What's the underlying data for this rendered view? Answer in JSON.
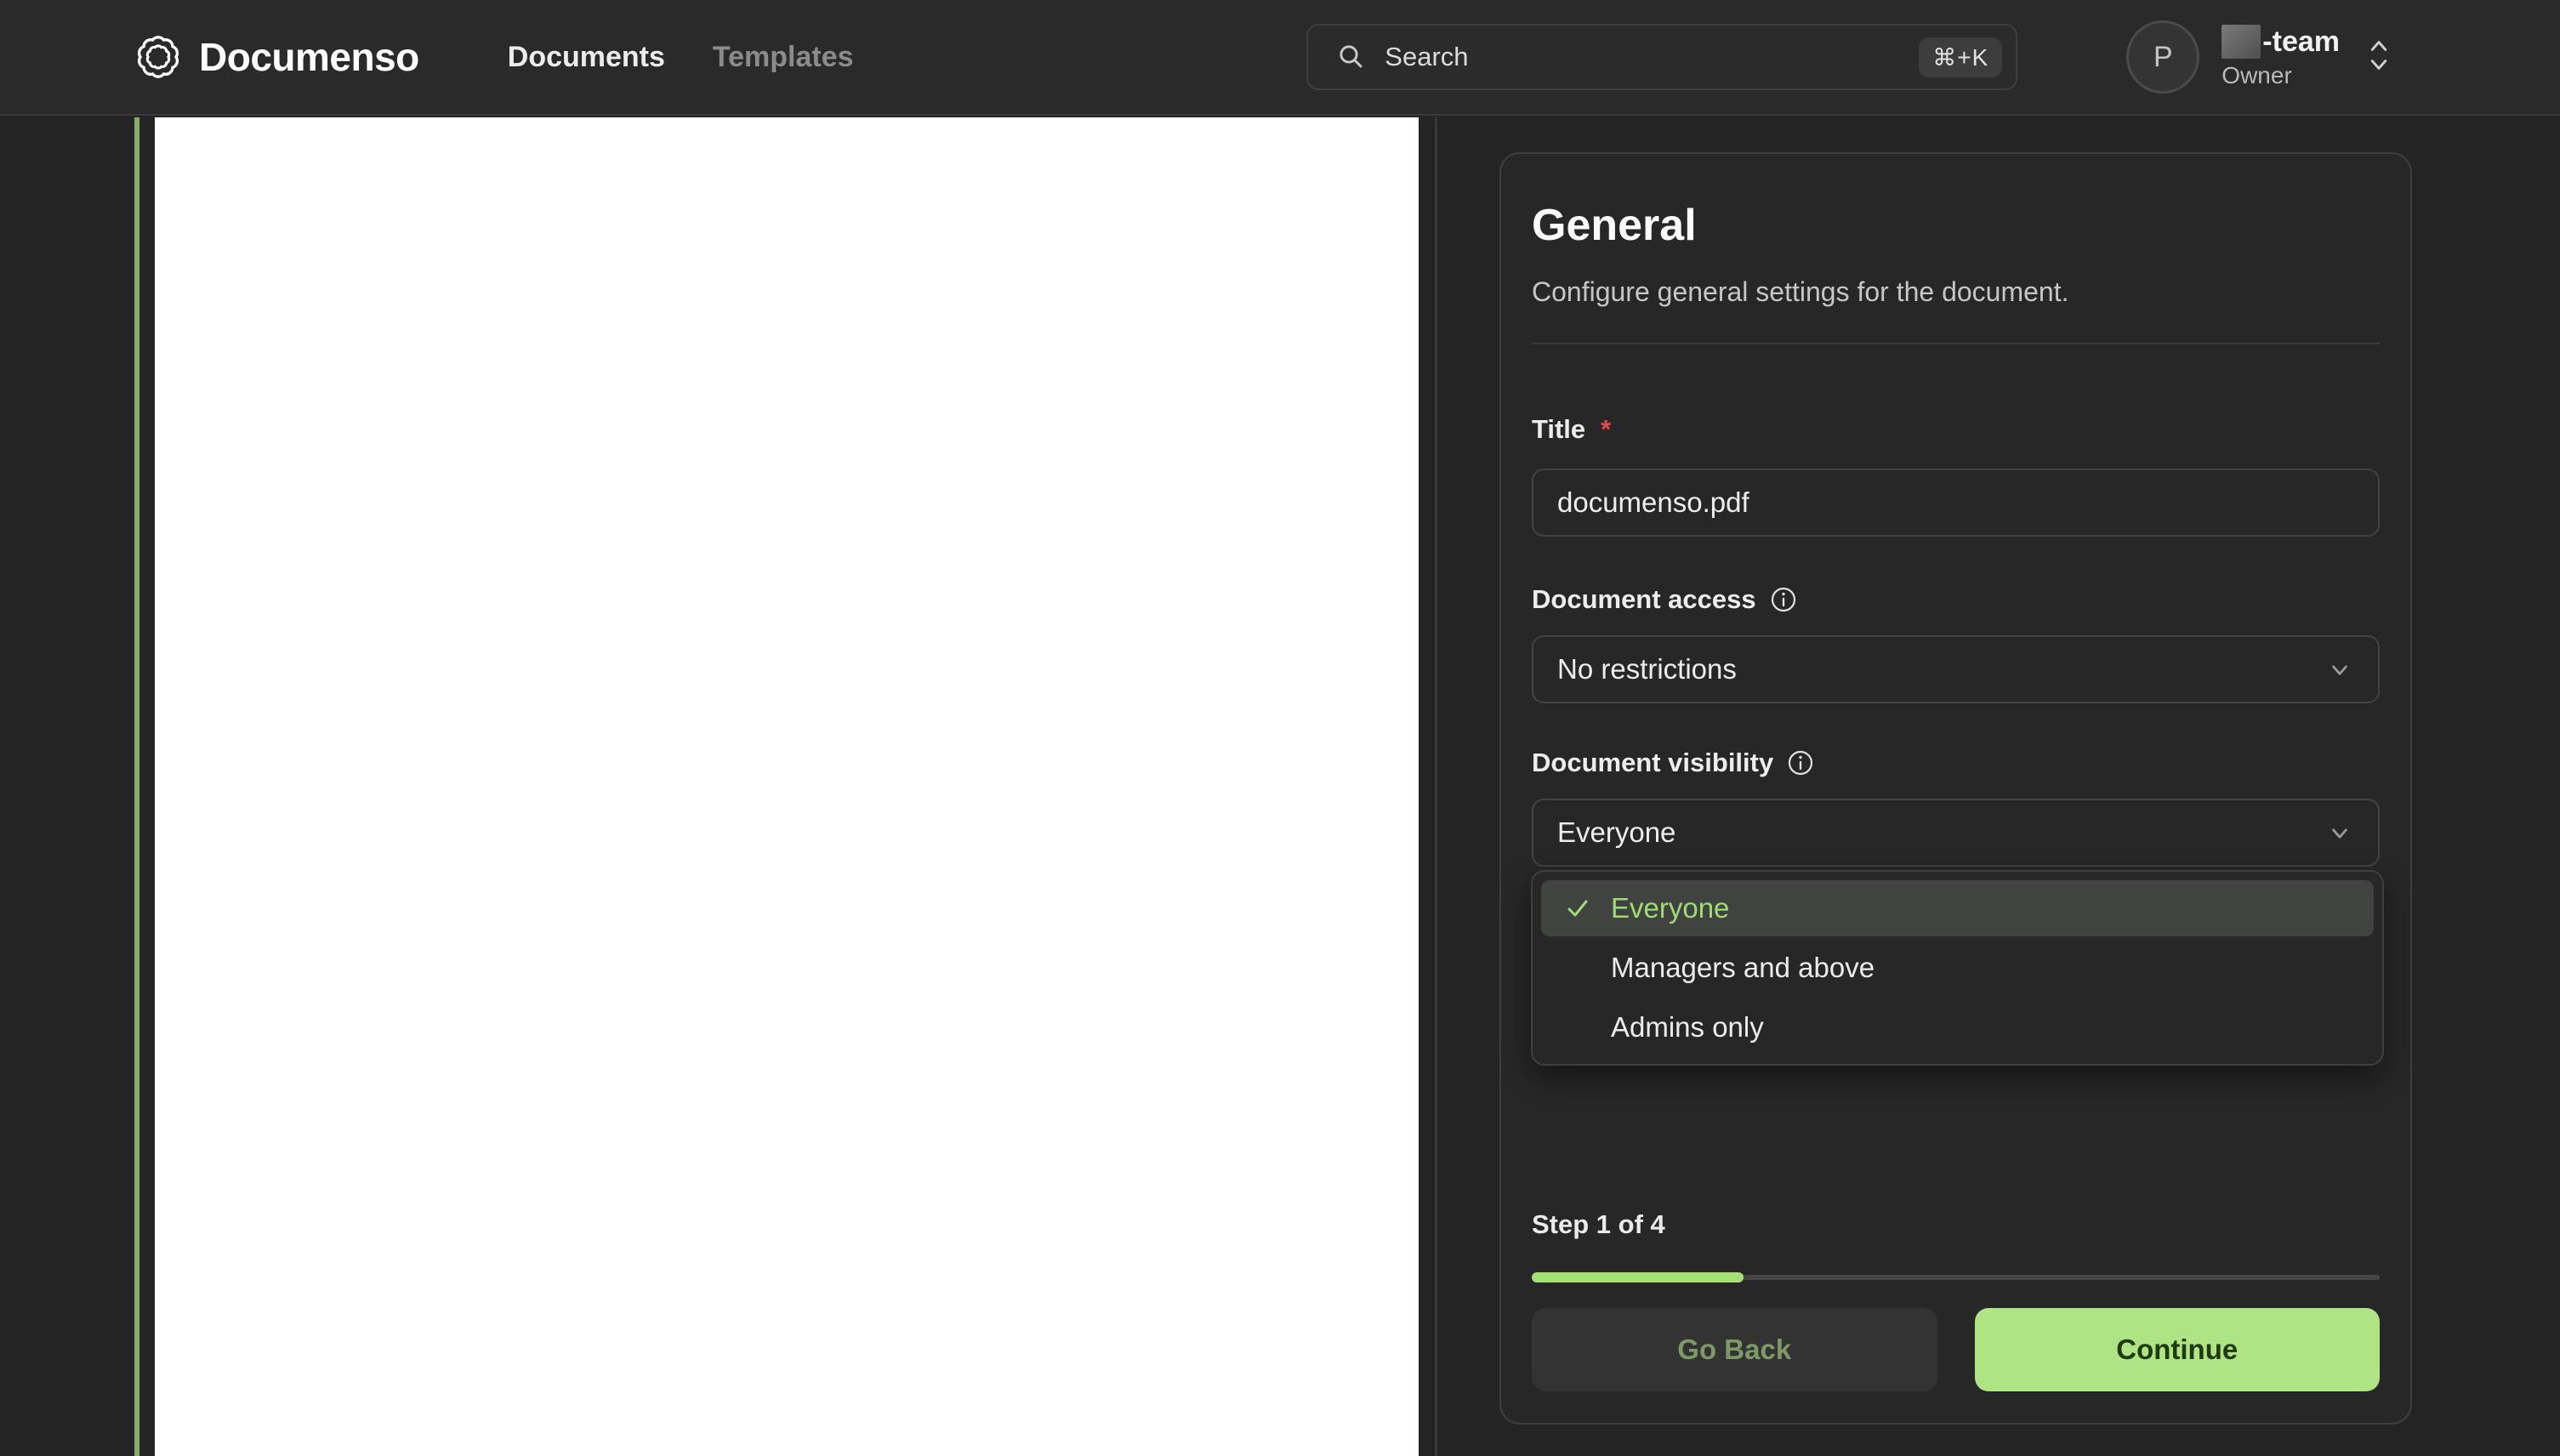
{
  "nav": {
    "brand": "Documenso",
    "links": [
      {
        "label": "Documents"
      },
      {
        "label": "Templates"
      }
    ],
    "search": {
      "placeholder": "Search",
      "shortcut": "⌘+K"
    },
    "user": {
      "avatar_initial": "P",
      "team_suffix": "-team",
      "role": "Owner"
    }
  },
  "panel": {
    "title": "General",
    "subtitle": "Configure general settings for the document.",
    "title_field": {
      "label": "Title",
      "required_marker": "*",
      "value": "documenso.pdf"
    },
    "access_field": {
      "label": "Document access",
      "value": "No restrictions"
    },
    "visibility_field": {
      "label": "Document visibility",
      "value": "Everyone"
    },
    "visibility_menu": {
      "options": [
        {
          "label": "Everyone",
          "selected": true
        },
        {
          "label": "Managers and above",
          "selected": false
        },
        {
          "label": "Admins only",
          "selected": false
        }
      ]
    },
    "step_label": "Step 1 of 4",
    "progress_percent": 25,
    "buttons": {
      "back": "Go Back",
      "continue": "Continue"
    }
  },
  "colors": {
    "accent_green": "#a5e077",
    "continue_bg": "#aee483",
    "continue_text": "#20390e",
    "selected_option_green": "#9edc74",
    "required_red": "#e5484d",
    "sidebar_line_green": "#8ba96f"
  }
}
